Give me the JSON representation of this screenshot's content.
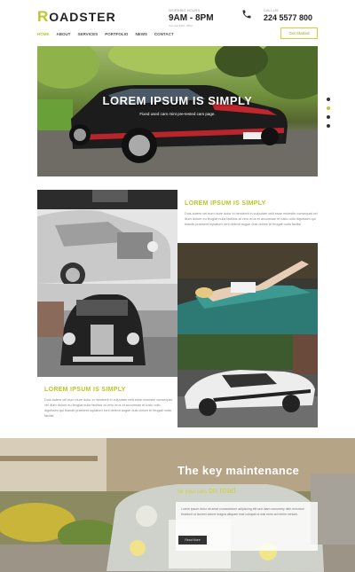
{
  "brand": {
    "logo_initial": "R",
    "logo_rest": "OADSTER"
  },
  "hours": {
    "label": "Working Hours",
    "value": "9AM - 8PM",
    "sub": "Sun-Sat 9AM - 8PM"
  },
  "phone": {
    "label": "Call Us",
    "value": "224 5577 800"
  },
  "nav": {
    "items": [
      "HOME",
      "ABOUT",
      "SERVICES",
      "PORTFOLIO",
      "NEWS",
      "CONTACT"
    ],
    "active_index": 0
  },
  "cta": {
    "label": "Get Started"
  },
  "hero": {
    "title": "LOREM IPSUM IS SIMPLY",
    "subtitle": "Fixed used cars mint pre-tested cars page."
  },
  "slider": {
    "count": 4,
    "active_index": 1
  },
  "section1": {
    "heading": "LOREM IPSUM IS SIMPLY",
    "body": "Duis autem vel eum iriure dolor in hendrerit in vulputate velit esse molestie consequat vel illum dolore eu feugiat nulla facilisis at vero eros et accumsan et iusto odio dignissim qui blandit praesent luptatum zzril delenit augue duis dolore te feugait nulla facilisi."
  },
  "section2": {
    "heading": "LOREM IPSUM IS SIMPLY",
    "body": "Duis autem vel eum iriure dolor in hendrerit in vulputate velit esse molestie consequat vel illum dolore eu feugiat nulla facilisis at vero eros et accumsan et iusto odio dignissim qui blandit praesent luptatum zzril delenit augue duis dolore te feugait nulla facilisi."
  },
  "banner": {
    "title": "The key maintenance",
    "subtitle_small": "for your cars",
    "subtitle_big": "on road",
    "body": "Lorem ipsum dolor sit amet consectetuer adipiscing elit sed diam nonummy nibh euismod tincidunt ut laoreet dolore magna aliquam erat volutpat ut wisi enim ad minim veniam.",
    "button": "Read More"
  },
  "colors": {
    "accent": "#b9c72a",
    "text_dark": "#222222"
  }
}
